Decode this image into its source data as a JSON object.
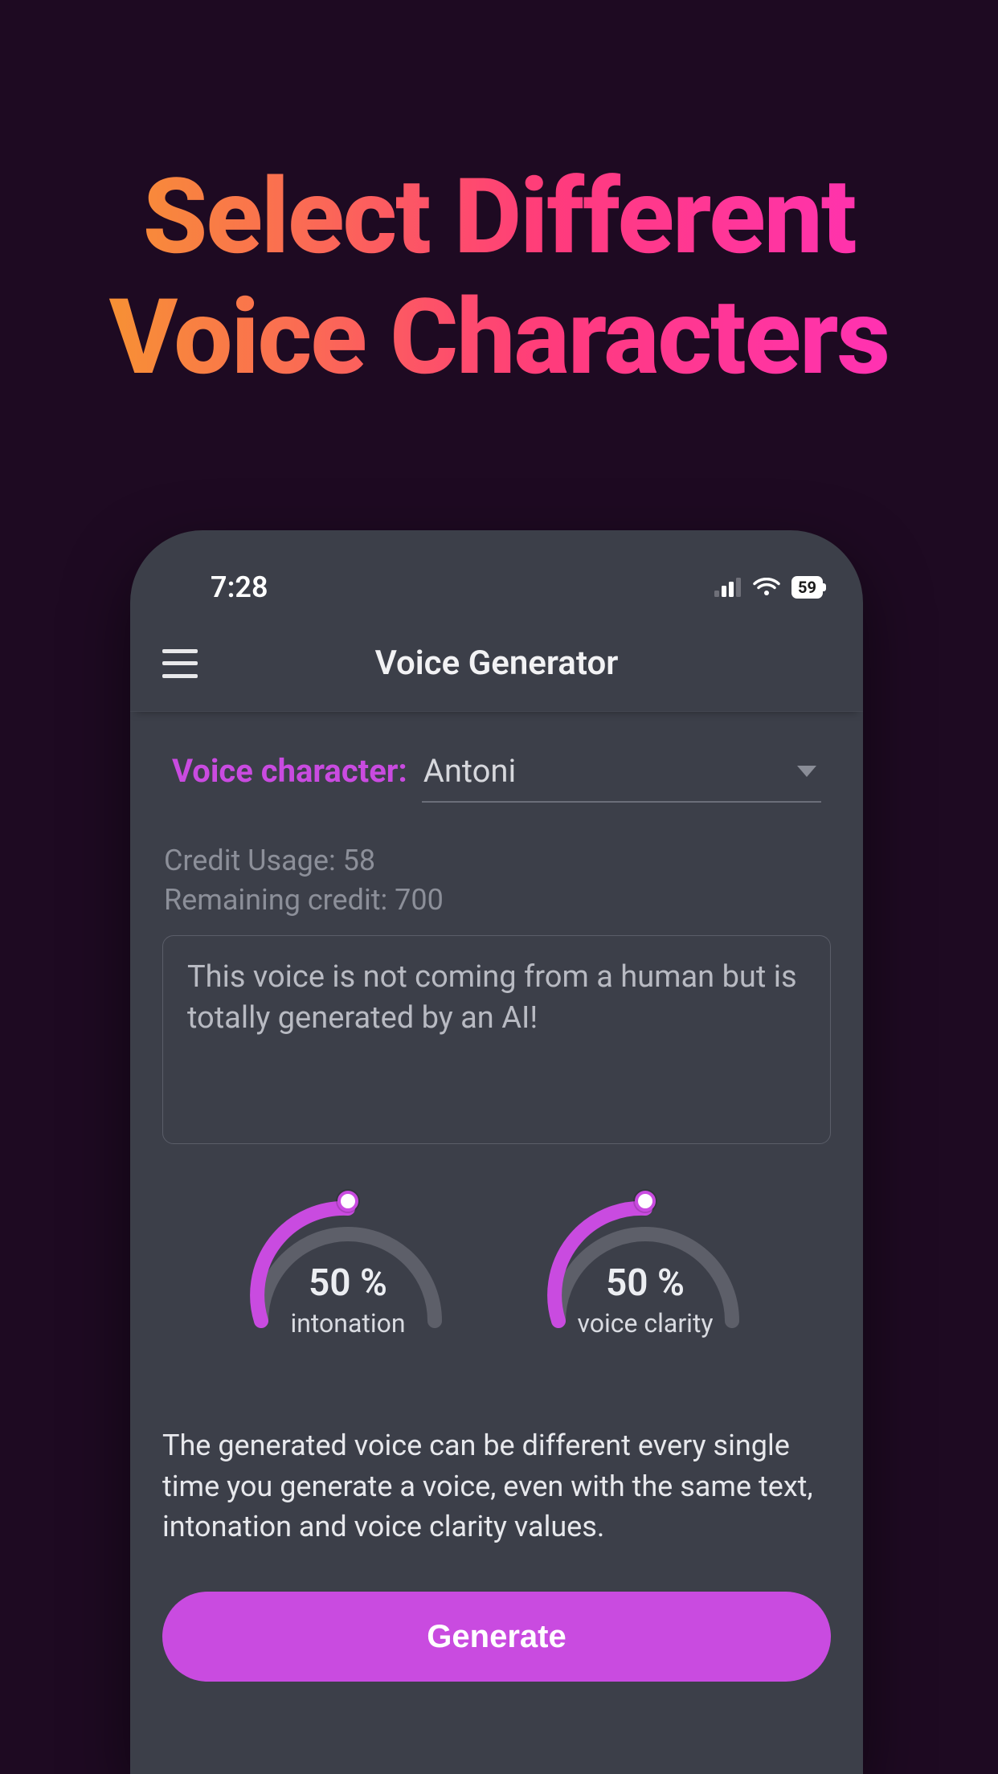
{
  "marketing": {
    "headline_line1": "Select Different",
    "headline_line2": "Voice Characters"
  },
  "status_bar": {
    "time": "7:28",
    "battery_percent": "59"
  },
  "navbar": {
    "title": "Voice Generator"
  },
  "voice_character": {
    "label": "Voice character:",
    "selected": "Antoni"
  },
  "credits": {
    "usage_label": "Credit Usage:",
    "usage_value": "58",
    "remaining_label": "Remaining credit:",
    "remaining_value": "700"
  },
  "text_input": {
    "value": "This voice is not coming from a human but is totally generated by an AI!"
  },
  "gauges": {
    "intonation": {
      "value_text": "50 %",
      "label": "intonation",
      "percent": 50
    },
    "voice_clarity": {
      "value_text": "50 %",
      "label": "voice clarity",
      "percent": 50
    }
  },
  "note": "The generated voice can be different every single time you generate a voice, even with the same text, intonation and voice clarity values.",
  "buttons": {
    "generate": "Generate"
  },
  "colors": {
    "accent": "#c94be0",
    "phone_bg": "#3c3f49",
    "page_bg": "#1e0a22"
  }
}
